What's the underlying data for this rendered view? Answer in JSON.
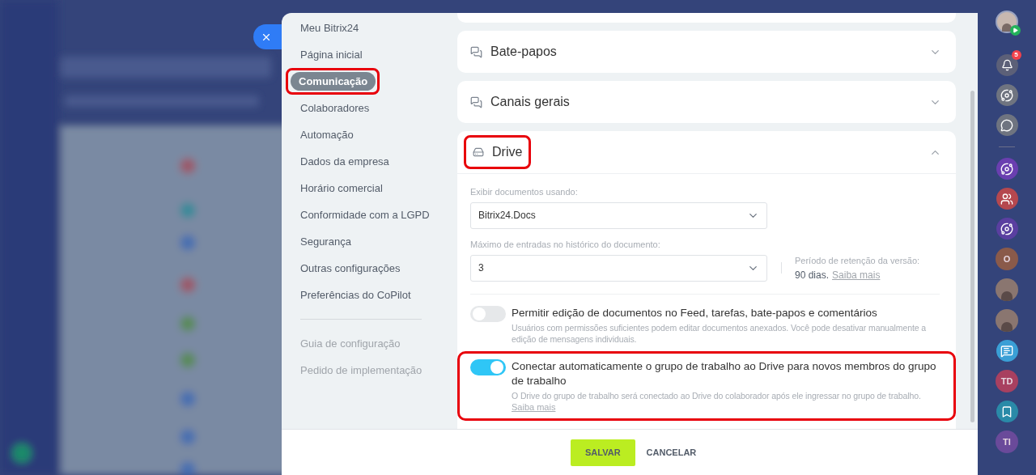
{
  "nav": {
    "items": [
      {
        "label": "Meu Bitrix24",
        "selected": false,
        "highlighted": false
      },
      {
        "label": "Página inicial",
        "selected": false,
        "highlighted": false
      },
      {
        "label": "Comunicação",
        "selected": true,
        "highlighted": true
      },
      {
        "label": "Colaboradores",
        "selected": false,
        "highlighted": false
      },
      {
        "label": "Automação",
        "selected": false,
        "highlighted": false
      },
      {
        "label": "Dados da empresa",
        "selected": false,
        "highlighted": false
      },
      {
        "label": "Horário comercial",
        "selected": false,
        "highlighted": false
      },
      {
        "label": "Conformidade com a LGPD",
        "selected": false,
        "highlighted": false
      },
      {
        "label": "Segurança",
        "selected": false,
        "highlighted": false
      },
      {
        "label": "Outras configurações",
        "selected": false,
        "highlighted": false
      },
      {
        "label": "Preferências do CoPilot",
        "selected": false,
        "highlighted": false
      }
    ],
    "secondary_items": [
      "Guia de configuração",
      "Pedido de implementação"
    ]
  },
  "sections": [
    {
      "title": "Bate-papos",
      "kind": "chats",
      "expanded": false,
      "highlighted": false
    },
    {
      "title": "Canais gerais",
      "kind": "chats",
      "expanded": false,
      "highlighted": false
    },
    {
      "title": "Drive",
      "kind": "drive",
      "expanded": true,
      "highlighted": true
    }
  ],
  "drive": {
    "view_label": "Exibir documentos usando:",
    "view_value": "Bitrix24.Docs",
    "history_label": "Máximo de entradas no histórico do documento:",
    "history_value": "3",
    "retention_label": "Período de retenção da versão:",
    "retention_value": "90 dias.",
    "retention_link": "Saiba mais",
    "toggles": [
      {
        "title": "Permitir edição de documentos no Feed, tarefas, bate-papos e comentários",
        "description": "Usuários com permissões suficientes podem editar documentos anexados. Você pode desativar manualmente a edição de mensagens individuais.",
        "on": false,
        "highlighted": false
      },
      {
        "title": "Conectar automaticamente o grupo de trabalho ao Drive para novos membros do grupo de trabalho",
        "description": "O Drive do grupo de trabalho será conectado ao Drive do colaborador após ele ingressar no grupo de trabalho.",
        "link": "Saiba mais",
        "on": true,
        "highlighted": true
      }
    ]
  },
  "footer": {
    "buttons": [
      {
        "label": "SALVAR",
        "kind": "primary"
      },
      {
        "label": "CANCELAR",
        "kind": "link"
      }
    ]
  },
  "right_rail": [
    {
      "kind": "user"
    },
    {
      "kind": "bell",
      "badge": "5"
    },
    {
      "kind": "spiral",
      "color": "#6f7480"
    },
    {
      "kind": "chat",
      "color": "#6f7480"
    },
    {
      "kind": "divider"
    },
    {
      "kind": "spiral",
      "color": "#6a3fb0"
    },
    {
      "kind": "users",
      "color": "#b5484f"
    },
    {
      "kind": "spiral",
      "color": "#5a3fa0"
    },
    {
      "kind": "letters",
      "text": "O",
      "color": "#8a5a4a"
    },
    {
      "kind": "avatar"
    },
    {
      "kind": "avatar"
    },
    {
      "kind": "message",
      "color": "#3a9fd6"
    },
    {
      "kind": "letters",
      "text": "TD",
      "color": "#a84060"
    },
    {
      "kind": "bookmark",
      "color": "#2a8aa8"
    },
    {
      "kind": "letters",
      "text": "TI",
      "color": "#6a4a9a"
    }
  ]
}
